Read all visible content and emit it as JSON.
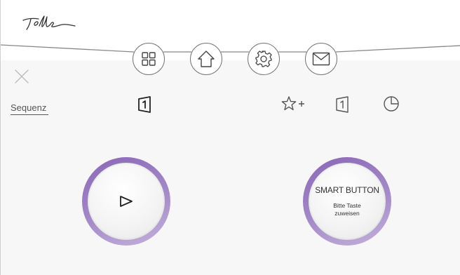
{
  "header": {
    "logo_text": "Feller",
    "nav": [
      {
        "name": "grid-icon"
      },
      {
        "name": "home-icon"
      },
      {
        "name": "gear-icon"
      },
      {
        "name": "mail-icon"
      }
    ]
  },
  "panel": {
    "close_icon": "close-icon",
    "sequence_label": "Sequenz",
    "toolbar_icons": [
      "favorite-add-icon",
      "scene-1-icon",
      "timer-icon"
    ],
    "selected_icon": "scene-1-icon"
  },
  "play_button": {
    "icon": "play-icon"
  },
  "smart_button": {
    "title": "SMART BUTTON",
    "subtitle_line1": "Bitte Taste",
    "subtitle_line2": "zuweisen"
  },
  "colors": {
    "ring_purple": "#9b7ec1",
    "icon_stroke": "#555555",
    "header_bg": "#ffffff",
    "body_bg": "#f7f7f7"
  }
}
